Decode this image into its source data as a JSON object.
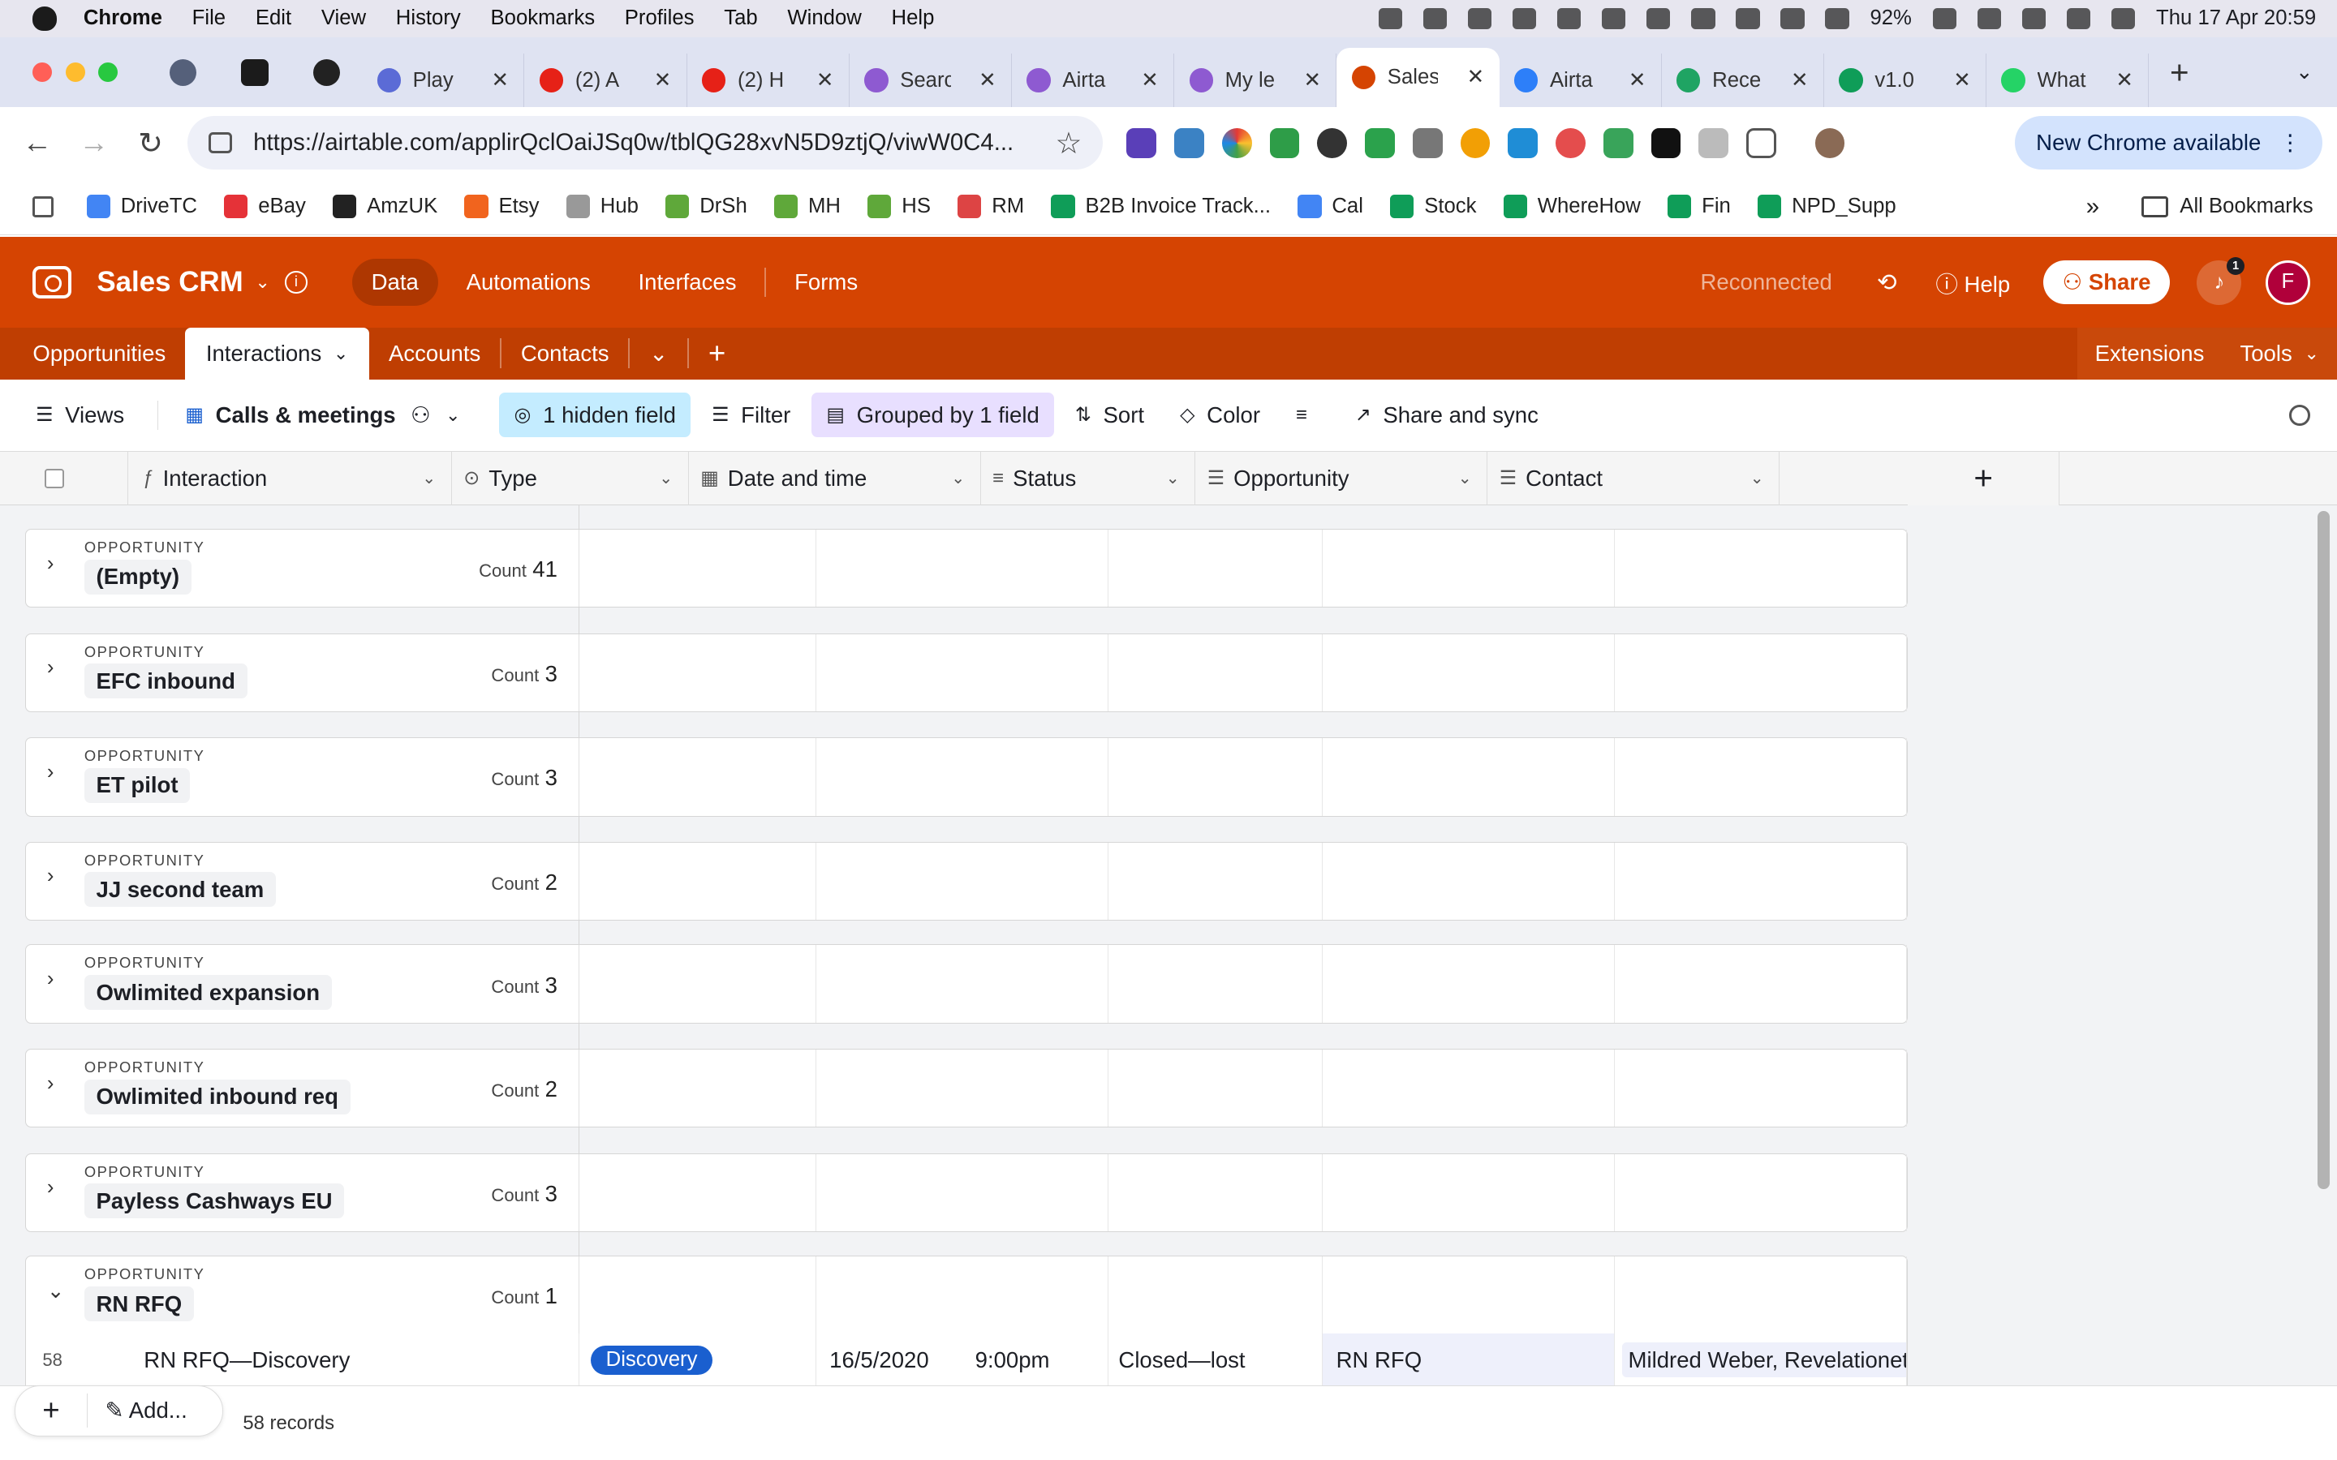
{
  "macbar": {
    "app": "Chrome",
    "menus": [
      "File",
      "Edit",
      "View",
      "History",
      "Bookmarks",
      "Profiles",
      "Tab",
      "Window",
      "Help"
    ],
    "battery": "92%",
    "datetime": "Thu 17 Apr  20:59"
  },
  "tabs": [
    {
      "label": "Play",
      "color": "#5b6bd6"
    },
    {
      "label": "(2) A",
      "color": "#e62117"
    },
    {
      "label": "(2) H",
      "color": "#e62117"
    },
    {
      "label": "Searc",
      "color": "#8e5ad1"
    },
    {
      "label": "Airta",
      "color": "#8e5ad1"
    },
    {
      "label": "My le",
      "color": "#8e5ad1"
    },
    {
      "label": "Sales",
      "color": "#d54402",
      "active": true
    },
    {
      "label": "Airta",
      "color": "#2d7ff9"
    },
    {
      "label": "Rece",
      "color": "#1fa463"
    },
    {
      "label": "v1.0",
      "color": "#0f9d58"
    },
    {
      "label": "What",
      "color": "#25d366"
    }
  ],
  "address": {
    "url": "https://airtable.com/applirQclOaiJSq0w/tblQG28xvN5D9ztjQ/viwW0C4...",
    "new_chrome": "New Chrome available"
  },
  "bookmarks": [
    {
      "label": "DriveTC",
      "color": "#4285f4"
    },
    {
      "label": "eBay",
      "color": "#e53238"
    },
    {
      "label": "AmzUK",
      "color": "#222"
    },
    {
      "label": "Etsy",
      "color": "#f1641e"
    },
    {
      "label": "Hub",
      "color": "#999"
    },
    {
      "label": "DrSh",
      "color": "#5fa83a"
    },
    {
      "label": "MH",
      "color": "#5fa83a"
    },
    {
      "label": "HS",
      "color": "#5fa83a"
    },
    {
      "label": "RM",
      "color": "#d44"
    },
    {
      "label": "B2B Invoice Track...",
      "color": "#0f9d58"
    },
    {
      "label": "Cal",
      "color": "#4285f4"
    },
    {
      "label": "Stock",
      "color": "#0f9d58"
    },
    {
      "label": "WhereHow",
      "color": "#0f9d58"
    },
    {
      "label": "Fin",
      "color": "#0f9d58"
    },
    {
      "label": "NPD_Supp",
      "color": "#0f9d58"
    }
  ],
  "all_bookmarks": "All Bookmarks",
  "app": {
    "base": "Sales CRM",
    "nav": [
      "Data",
      "Automations",
      "Interfaces",
      "Forms"
    ],
    "status": "Reconnected",
    "help": "Help",
    "share": "Share",
    "notif": "1",
    "avatar": "F"
  },
  "tables": [
    "Opportunities",
    "Interactions",
    "Accounts",
    "Contacts"
  ],
  "right_tools": [
    "Extensions",
    "Tools"
  ],
  "viewbar": {
    "views": "Views",
    "view_name": "Calls & meetings",
    "hidden": "1 hidden field",
    "filter": "Filter",
    "grouped": "Grouped by 1 field",
    "sort": "Sort",
    "color": "Color",
    "share_sync": "Share and sync"
  },
  "columns": [
    "Interaction",
    "Type",
    "Date and time",
    "Status",
    "Opportunity",
    "Contact"
  ],
  "group_label": "OPPORTUNITY",
  "count_label": "Count",
  "groups": [
    {
      "name": "(Empty)",
      "count": "41",
      "expanded": false
    },
    {
      "name": "EFC inbound",
      "count": "3",
      "expanded": false
    },
    {
      "name": "ET pilot",
      "count": "3",
      "expanded": false
    },
    {
      "name": "JJ second team",
      "count": "2",
      "expanded": false
    },
    {
      "name": "Owlimited expansion",
      "count": "3",
      "expanded": false
    },
    {
      "name": "Owlimited inbound req",
      "count": "2",
      "expanded": false
    },
    {
      "name": "Payless Cashways EU",
      "count": "3",
      "expanded": false
    },
    {
      "name": "RN RFQ",
      "count": "1",
      "expanded": true
    }
  ],
  "record": {
    "num": "58",
    "interaction": "RN RFQ—Discovery",
    "type": "Discovery",
    "date": "16/5/2020",
    "time": "9:00pm",
    "status": "Closed—lost",
    "opportunity": "RN RFQ",
    "contact": "Mildred Weber, Revelationet"
  },
  "footer": {
    "add": "Add...",
    "records": "58 records"
  }
}
